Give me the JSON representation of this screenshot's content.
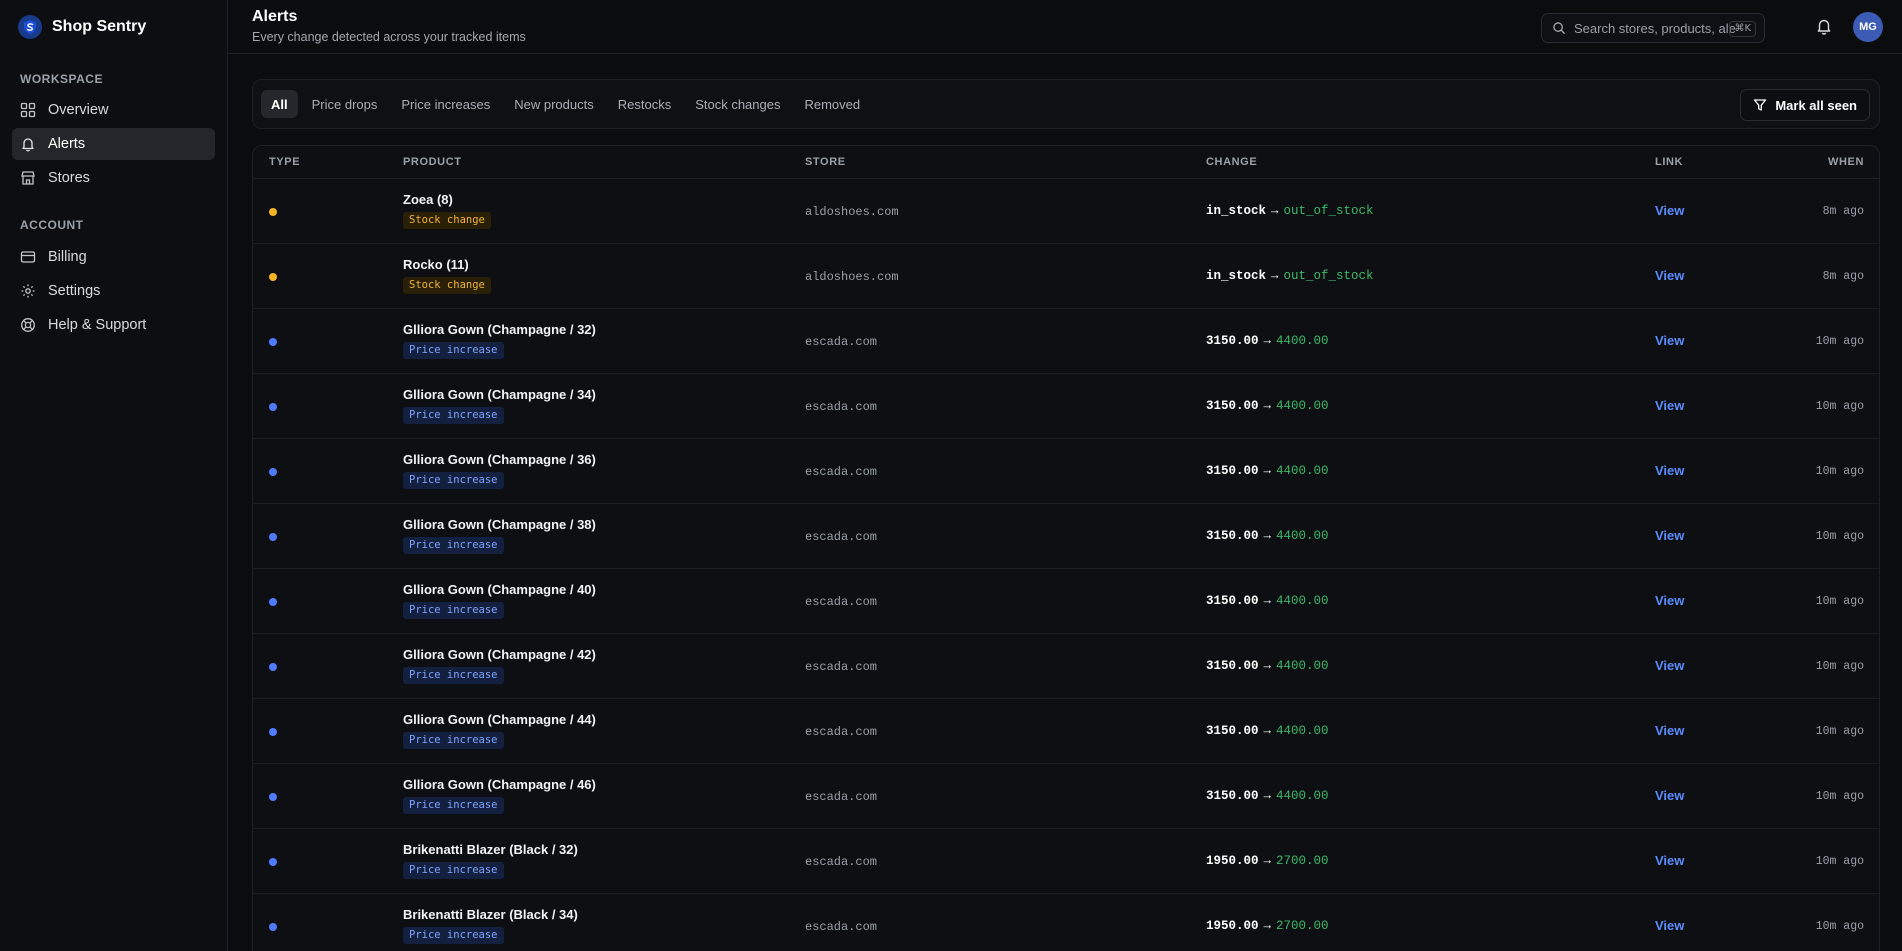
{
  "brand": {
    "name": "Shop Sentry",
    "logo_icon": "shield-s-icon"
  },
  "sidebar": {
    "workspace_label": "WORKSPACE",
    "account_label": "ACCOUNT",
    "workspace_items": [
      {
        "label": "Overview",
        "icon": "grid-icon",
        "active": false
      },
      {
        "label": "Alerts",
        "icon": "bell-icon",
        "active": true
      },
      {
        "label": "Stores",
        "icon": "store-icon",
        "active": false
      }
    ],
    "account_items": [
      {
        "label": "Billing",
        "icon": "credit-card-icon"
      },
      {
        "label": "Settings",
        "icon": "gear-icon"
      },
      {
        "label": "Help & Support",
        "icon": "lifebuoy-icon"
      }
    ]
  },
  "header": {
    "title": "Alerts",
    "subtitle": "Every change detected across your tracked items",
    "search_placeholder": "Search stores, products, ale",
    "search_shortcut": "⌘K",
    "avatar_initials": "MG"
  },
  "filters": {
    "tabs": [
      "All",
      "Price drops",
      "Price increases",
      "New products",
      "Restocks",
      "Stock changes",
      "Removed"
    ],
    "active_index": 0,
    "mark_all_label": "Mark all seen"
  },
  "table": {
    "columns": {
      "type": "TYPE",
      "product": "PRODUCT",
      "store": "STORE",
      "change": "CHANGE",
      "link": "LINK",
      "when": "WHEN"
    },
    "rows": [
      {
        "kind": "stock",
        "product": "Zoea (8)",
        "tag": "Stock change",
        "store": "aldoshoes.com",
        "old": "in_stock",
        "arrow": "→",
        "new": "out_of_stock",
        "link": "View",
        "when": "8m ago"
      },
      {
        "kind": "stock",
        "product": "Rocko (11)",
        "tag": "Stock change",
        "store": "aldoshoes.com",
        "old": "in_stock",
        "arrow": "→",
        "new": "out_of_stock",
        "link": "View",
        "when": "8m ago"
      },
      {
        "kind": "price",
        "product": "Glliora Gown (Champagne / 32)",
        "tag": "Price increase",
        "store": "escada.com",
        "old": "3150.00",
        "arrow": "→",
        "new": "4400.00",
        "link": "View",
        "when": "10m ago"
      },
      {
        "kind": "price",
        "product": "Glliora Gown (Champagne / 34)",
        "tag": "Price increase",
        "store": "escada.com",
        "old": "3150.00",
        "arrow": "→",
        "new": "4400.00",
        "link": "View",
        "when": "10m ago"
      },
      {
        "kind": "price",
        "product": "Glliora Gown (Champagne / 36)",
        "tag": "Price increase",
        "store": "escada.com",
        "old": "3150.00",
        "arrow": "→",
        "new": "4400.00",
        "link": "View",
        "when": "10m ago"
      },
      {
        "kind": "price",
        "product": "Glliora Gown (Champagne / 38)",
        "tag": "Price increase",
        "store": "escada.com",
        "old": "3150.00",
        "arrow": "→",
        "new": "4400.00",
        "link": "View",
        "when": "10m ago"
      },
      {
        "kind": "price",
        "product": "Glliora Gown (Champagne / 40)",
        "tag": "Price increase",
        "store": "escada.com",
        "old": "3150.00",
        "arrow": "→",
        "new": "4400.00",
        "link": "View",
        "when": "10m ago"
      },
      {
        "kind": "price",
        "product": "Glliora Gown (Champagne / 42)",
        "tag": "Price increase",
        "store": "escada.com",
        "old": "3150.00",
        "arrow": "→",
        "new": "4400.00",
        "link": "View",
        "when": "10m ago"
      },
      {
        "kind": "price",
        "product": "Glliora Gown (Champagne / 44)",
        "tag": "Price increase",
        "store": "escada.com",
        "old": "3150.00",
        "arrow": "→",
        "new": "4400.00",
        "link": "View",
        "when": "10m ago"
      },
      {
        "kind": "price",
        "product": "Glliora Gown (Champagne / 46)",
        "tag": "Price increase",
        "store": "escada.com",
        "old": "3150.00",
        "arrow": "→",
        "new": "4400.00",
        "link": "View",
        "when": "10m ago"
      },
      {
        "kind": "price",
        "product": "Brikenatti Blazer (Black / 32)",
        "tag": "Price increase",
        "store": "escada.com",
        "old": "1950.00",
        "arrow": "→",
        "new": "2700.00",
        "link": "View",
        "when": "10m ago"
      },
      {
        "kind": "price",
        "product": "Brikenatti Blazer (Black / 34)",
        "tag": "Price increase",
        "store": "escada.com",
        "old": "1950.00",
        "arrow": "→",
        "new": "2700.00",
        "link": "View",
        "when": "10m ago"
      }
    ]
  },
  "colors": {
    "stock_dot": "#f5b324",
    "price_dot": "#4f7cff",
    "link": "#5b8cff",
    "new_value": "#3fb96b",
    "avatar_bg": "#3b5bb4"
  }
}
